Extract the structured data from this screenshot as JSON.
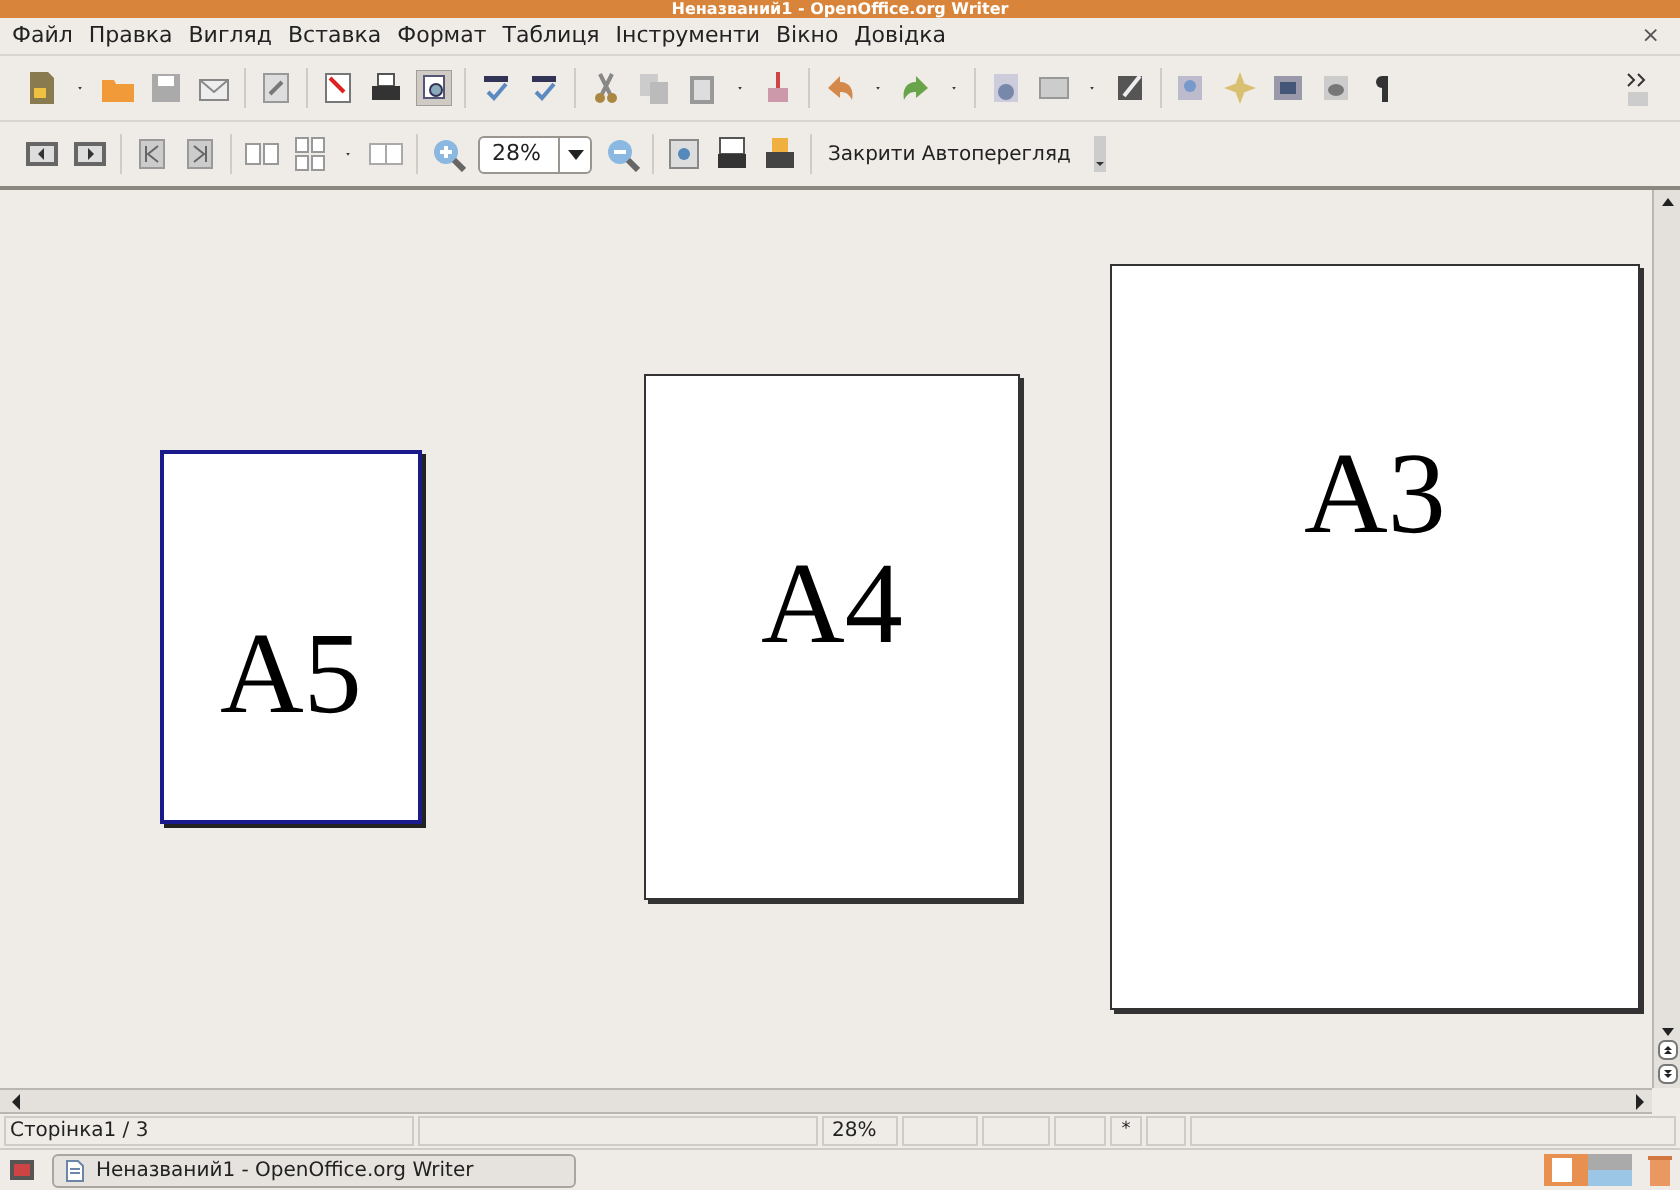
{
  "window": {
    "title": "Неназваний1 - OpenOffice.org Writer",
    "close": "×"
  },
  "menu": [
    {
      "label": "Файл"
    },
    {
      "label": "Правка"
    },
    {
      "label": "Вигляд"
    },
    {
      "label": "Вставка"
    },
    {
      "label": "Формат"
    },
    {
      "label": "Таблиця"
    },
    {
      "label": "Інструменти"
    },
    {
      "label": "Вікно"
    },
    {
      "label": "Довідка"
    }
  ],
  "preview_toolbar": {
    "zoom": "28%",
    "close_preview": "Закрити Автоперегляд"
  },
  "pages": [
    {
      "label": "A5",
      "kind": "a5",
      "selected": true
    },
    {
      "label": "A4",
      "kind": "a4",
      "selected": false
    },
    {
      "label": "A3",
      "kind": "a3",
      "selected": false
    }
  ],
  "status_bar": {
    "page": "Сторінка1 / 3",
    "zoom": "28%",
    "modified": "*"
  },
  "taskbar": {
    "item": "Неназваний1 - OpenOffice.org Writer"
  }
}
